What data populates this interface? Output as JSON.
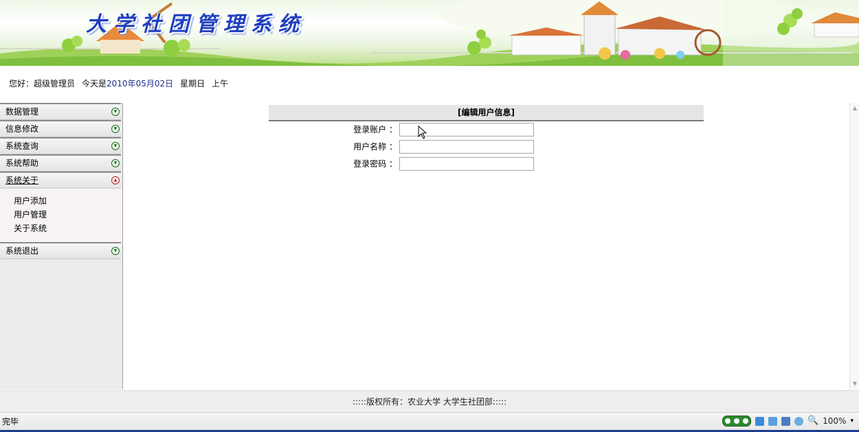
{
  "banner": {
    "title": "大学社团管理系统"
  },
  "greeting": {
    "hello": "您好：超级管理员",
    "today_label": "今天是",
    "date": "2010年05月02日",
    "weekday": "星期日",
    "period": "上午"
  },
  "sidebar": {
    "menus": [
      {
        "label": "数据管理",
        "open": false
      },
      {
        "label": "信息修改",
        "open": false
      },
      {
        "label": "系统查询",
        "open": false
      },
      {
        "label": "系统帮助",
        "open": false
      },
      {
        "label": "系统关于",
        "open": true
      },
      {
        "label": "系统退出",
        "open": false
      }
    ],
    "submenu": [
      "用户添加",
      "用户管理",
      "关于系统"
    ]
  },
  "form": {
    "title": "[编辑用户信息]",
    "fields": [
      {
        "label": "登录账户 ：",
        "value": ""
      },
      {
        "label": "用户名称 ：",
        "value": ""
      },
      {
        "label": "登录密码 ：",
        "value": ""
      }
    ]
  },
  "footer": {
    "text": ":::::版权所有：农业大学 大学生社团部:::::"
  },
  "statusbar": {
    "status": "完毕",
    "zoom": "100%"
  },
  "colors": {
    "title_blue": "#1f3fbf",
    "grass_green": "#7fbf3f",
    "status_green": "#2f8a2f"
  }
}
